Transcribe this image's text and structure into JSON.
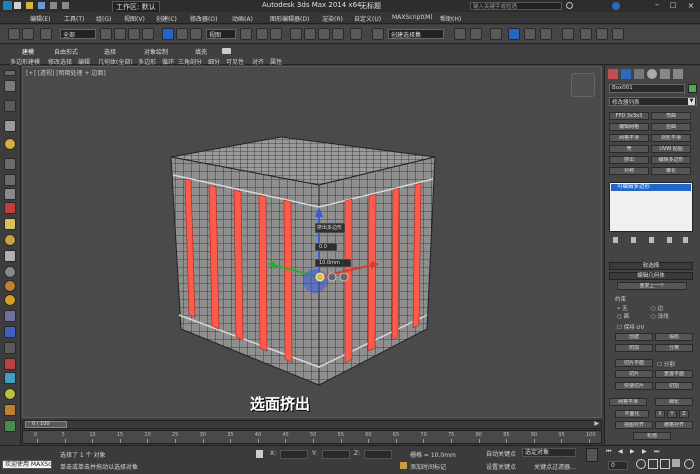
{
  "titlebar": {
    "workspace_label": "工作区: 默认",
    "app_title": "Autodesk 3ds Max 2014 x64",
    "file_title": "无标题",
    "search_placeholder": "键入关键字或短语"
  },
  "menu": [
    "编辑(E)",
    "工具(T)",
    "组(G)",
    "视图(V)",
    "创建(C)",
    "修改器(O)",
    "动画(A)",
    "图形编辑器(D)",
    "渲染(R)",
    "自定义(U)",
    "MAXScript(M)",
    "帮助(H)"
  ],
  "toolbar": {
    "filter_select": "全部",
    "view_select": "视图",
    "named_selection": "创建选择集"
  },
  "ribbon": {
    "tabs": [
      "建模",
      "自由形式",
      "选择",
      "对象绘制",
      "填充"
    ],
    "subtabs": [
      "多边形建模",
      "修改选择",
      "编辑",
      "几何体(全部)",
      "多边形",
      "循环",
      "三角剖分",
      "细分",
      "可见性",
      "对齐",
      "属性"
    ]
  },
  "viewport": {
    "label": "[+] [透视] [明暗处理 + 边面]",
    "caption": "选面挤出",
    "caddy": {
      "title": "挤出多边形",
      "value1": "0.0",
      "value2": "10.0mm"
    }
  },
  "command_panel": {
    "object_name": "Box001",
    "modifier_list": "修改器列表",
    "buttons": [
      "FFD 3x3x3",
      "弯曲",
      "编辑网格",
      "扭曲",
      "网格平滑",
      "涡轮平滑",
      "壳",
      "UVW 贴图",
      "挤出",
      "编辑多边形",
      "对称",
      "锥化"
    ],
    "stack_item": "可编辑多边形",
    "rollouts": {
      "soft_selection": "软选择",
      "edit_geometry": "编辑几何体",
      "repeat_last": "重复上一个"
    },
    "constraints": {
      "title": "约束",
      "none": "无",
      "edge": "边",
      "face": "面",
      "normal": "法线"
    },
    "preserve_uv": "保持 UV",
    "create": "创建",
    "collapse": "塌陷",
    "attach": "附加",
    "detach": "分离",
    "slice_plane": "切片平面",
    "split": "分割",
    "slice": "切片",
    "reset_plane": "重置平面",
    "quickslice": "快速切片",
    "cut": "切割",
    "meshsmooth": "网格平滑",
    "tessellate": "细化",
    "planarize": "平面化",
    "x": "X",
    "y": "Y",
    "z": "Z",
    "view_align": "视图对齐",
    "grid_align": "栅格对齐",
    "relax": "松弛"
  },
  "timeline": {
    "slider": "0 / 100",
    "ticks": [
      "0",
      "5",
      "10",
      "15",
      "20",
      "25",
      "30",
      "35",
      "40",
      "45",
      "50",
      "55",
      "60",
      "65",
      "70",
      "75",
      "80",
      "85",
      "90",
      "95",
      "100"
    ]
  },
  "status": {
    "maxscript_label": "欢迎使用 MAXSc",
    "selected": "选择了 1 个 对象",
    "prompt": "单击或单击并拖动以选择对象",
    "grid": "栅格 = 10.0mm",
    "auto_key": "自动关键点",
    "set_key": "设置关键点",
    "selected_object": "选定对象",
    "key_filters": "关键点过滤器...",
    "add_time_tag": "添加时间标记",
    "x_label": "X:",
    "y_label": "Y:",
    "z_label": "Z:",
    "frame": "0"
  },
  "colors": {
    "accent": "#2266c8",
    "red_strip": "#ff5a4a",
    "background": "#3a3a3a"
  }
}
